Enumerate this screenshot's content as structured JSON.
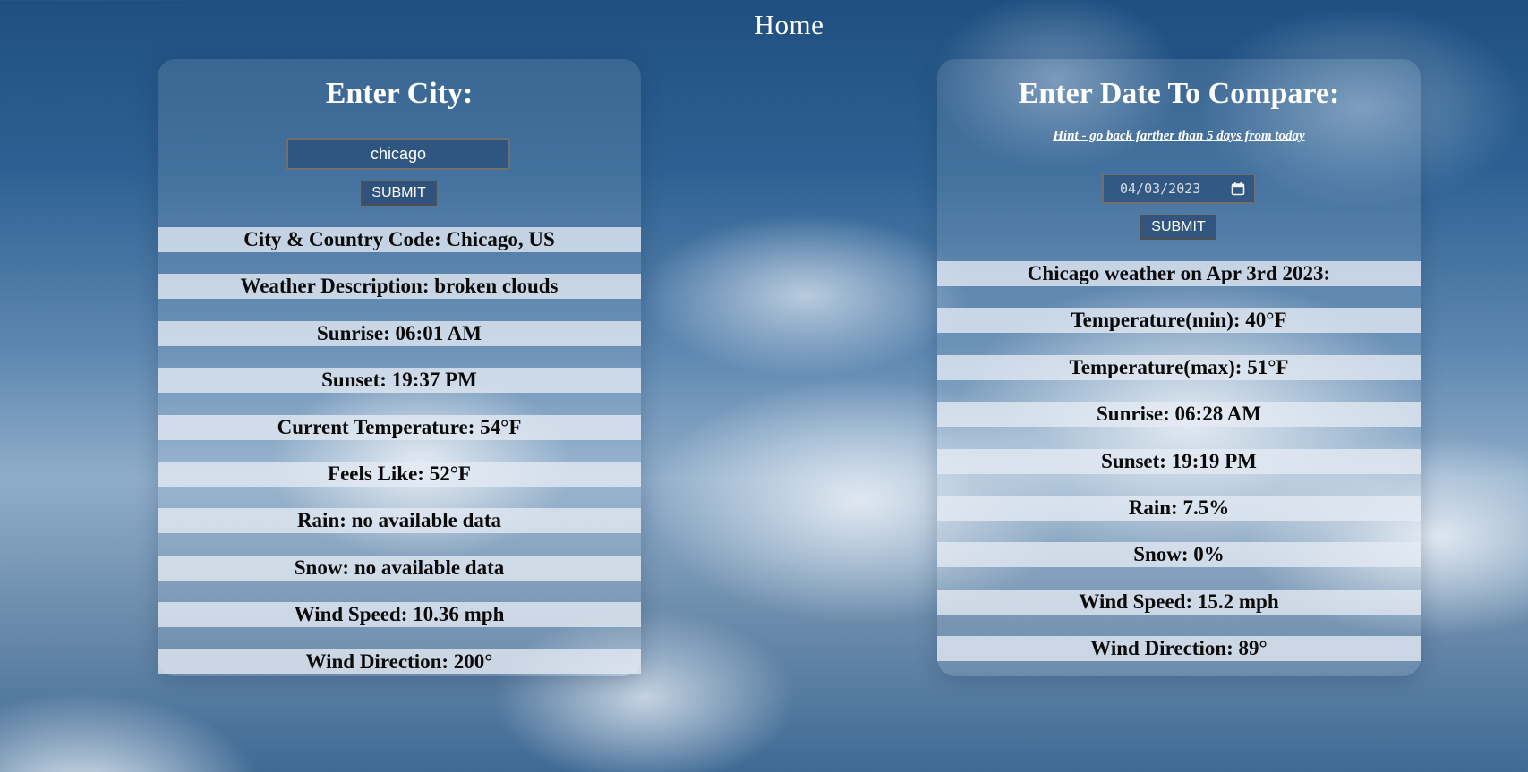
{
  "header": {
    "title": "Home"
  },
  "city_panel": {
    "heading": "Enter City:",
    "input_value": "chicago",
    "submit_label": "SUBMIT",
    "rows": [
      "City & Country Code: Chicago, US",
      "Weather Description: broken clouds",
      "Sunrise: 06:01 AM",
      "Sunset: 19:37 PM",
      "Current Temperature: 54°F",
      "Feels Like: 52°F",
      "Rain: no available data",
      "Snow: no available data",
      "Wind Speed: 10.36 mph",
      "Wind Direction: 200°"
    ]
  },
  "compare_panel": {
    "heading": "Enter Date To Compare:",
    "hint": "Hint - go back farther than 5 days from today",
    "date_value": "04/03/2023",
    "submit_label": "SUBMIT",
    "rows": [
      "Chicago weather on Apr 3rd 2023:",
      "Temperature(min): 40°F",
      "Temperature(max): 51°F",
      "Sunrise: 06:28 AM",
      "Sunset: 19:19 PM",
      "Rain: 7.5%",
      "Snow: 0%",
      "Wind Speed: 15.2 mph",
      "Wind Direction: 89°"
    ]
  },
  "icons": {
    "date_picker": "calendar-icon"
  }
}
